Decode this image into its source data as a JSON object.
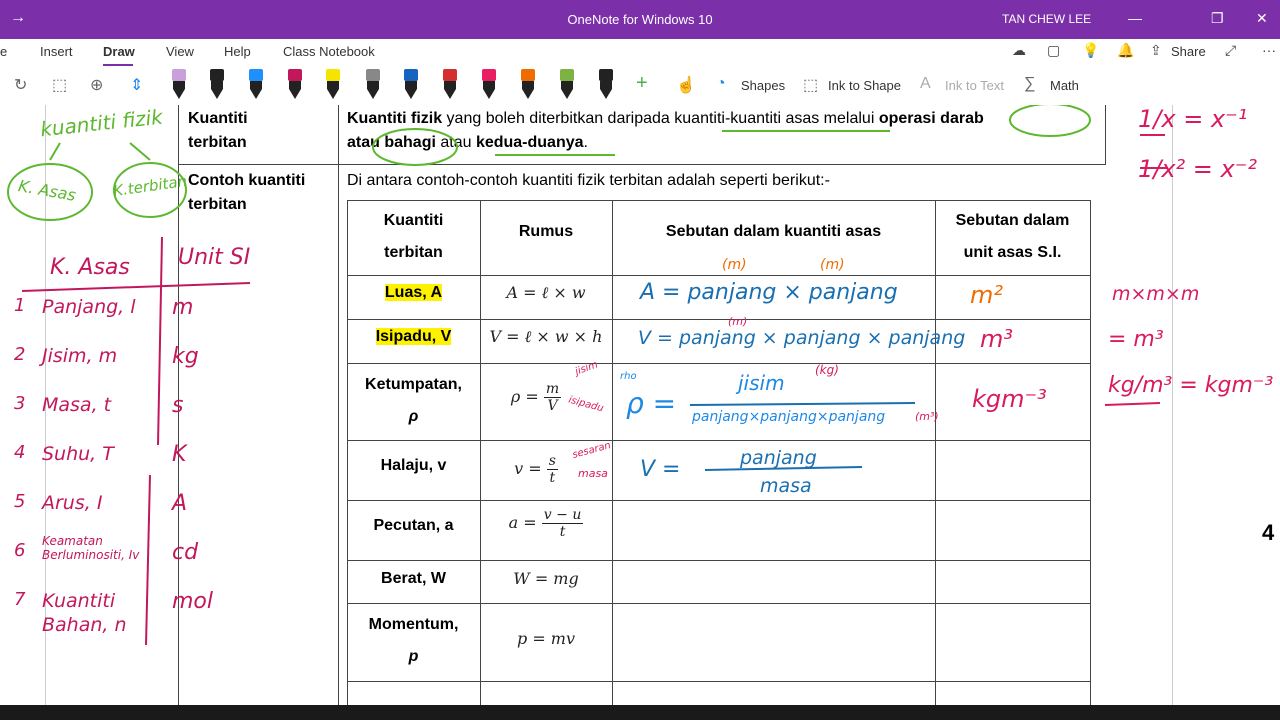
{
  "app": {
    "title": "OneNote for Windows 10",
    "user": "TAN CHEW LEE"
  },
  "menu": {
    "items": [
      "e",
      "Insert",
      "Draw",
      "View",
      "Help",
      "Class Notebook"
    ],
    "share_label": "Share"
  },
  "toolbar": {
    "shapes_label": "Shapes",
    "ink_to_shape_label": "Ink to Shape",
    "ink_to_text_label": "Ink to Text",
    "math_label": "Math",
    "pens": [
      {
        "color": "#c9a0dc"
      },
      {
        "color": "#222222"
      },
      {
        "color": "#1e90ff"
      },
      {
        "color": "#c2185b"
      },
      {
        "color": "#f5e400"
      },
      {
        "color": "#888888"
      },
      {
        "color": "#1565c0"
      },
      {
        "color": "#d32f2f"
      },
      {
        "color": "#e91e63"
      },
      {
        "color": "#ef6c00"
      },
      {
        "color": "#7cb342"
      },
      {
        "color": "#222222"
      }
    ]
  },
  "doc": {
    "row1_label_1": "Kuantiti",
    "row1_label_2": "terbitan",
    "def_b1": "Kuantiti fizik",
    "def_t1": " yang boleh diterbitkan daripada kuantiti-kuantiti asas melalui ",
    "def_b2": "operasi darab",
    "def_b3": "atau bahagi",
    "def_t2": " atau ",
    "def_b4": "kedua-duanya",
    "def_t3": ".",
    "row2_label_1": "Contoh kuantiti",
    "row2_label_2": "terbitan",
    "intro": "Di antara contoh-contoh kuantiti fizik terbitan adalah seperti berikut:-",
    "headers": {
      "col1_a": "Kuantiti",
      "col1_b": "terbitan",
      "col2": "Rumus",
      "col3": "Sebutan dalam kuantiti asas",
      "col4_a": "Sebutan dalam",
      "col4_b": "unit asas S.I."
    },
    "rows": [
      {
        "name": "Luas, A",
        "formula": "A = ℓ × w"
      },
      {
        "name": "Isipadu, V",
        "formula": "V = ℓ × w × h"
      },
      {
        "name_a": "Ketumpatan,",
        "name_b": "ρ",
        "formula_lhs": "ρ =",
        "num": "m",
        "den": "V"
      },
      {
        "name": "Halaju, v",
        "formula_lhs": "v =",
        "num": "s",
        "den": "t"
      },
      {
        "name": "Pecutan, a",
        "formula_lhs": "a =",
        "num": "v − u",
        "den": "t"
      },
      {
        "name": "Berat, W",
        "formula": "W = mg"
      },
      {
        "name_a": "Momentum,",
        "name_b": "p",
        "formula": "p = mv"
      }
    ],
    "page_number": "4"
  },
  "ink": {
    "top_left": "kuantiti fizik",
    "k_asas": "K. Asas",
    "k_terbitan": "K.terbitan",
    "side_header_1": "K. Asas",
    "side_header_2": "Unit SI",
    "side_list": [
      {
        "n": "1",
        "q": "Panjang, l",
        "u": "m"
      },
      {
        "n": "2",
        "q": "Jisim, m",
        "u": "kg"
      },
      {
        "n": "3",
        "q": "Masa, t",
        "u": "s"
      },
      {
        "n": "4",
        "q": "Suhu, T",
        "u": "K"
      },
      {
        "n": "5",
        "q": "Arus, I",
        "u": "A"
      },
      {
        "n": "6",
        "q": "Keamatan Berluminositi, Iv",
        "u": "cd"
      },
      {
        "n": "7",
        "q": "Kuantiti Bahan, n",
        "u": "mol"
      }
    ],
    "luas_expr": "A = panjang × panjang",
    "luas_m1": "(m)",
    "luas_m2": "(m)",
    "luas_unit": "m²",
    "isipadu_expr": "V = panjang × panjang × panjang",
    "isipadu_m": "(m)",
    "isipadu_unit": "m³",
    "ketumpatan_lhs": "ρ =",
    "ketumpatan_rho": "rho",
    "ketumpatan_num": "jisim",
    "ketumpatan_kg": "(kg)",
    "ketumpatan_den": "panjang×panjang×panjang",
    "ketumpatan_m3": "(m³)",
    "ketumpatan_unit": "kgm⁻³",
    "rumus_jisim": "jisim",
    "rumus_isipadu": "isipadu",
    "rumus_sesaran": "sesaran",
    "rumus_masa": "masa",
    "halaju_lhs": "V =",
    "halaju_num": "panjang",
    "halaju_den": "masa",
    "right_1": "1/x = x⁻¹",
    "right_2": "1/x² = x⁻²",
    "right_3": "m×m×m",
    "right_4": "= m³",
    "right_5": "kg/m³ = kgm⁻³"
  }
}
